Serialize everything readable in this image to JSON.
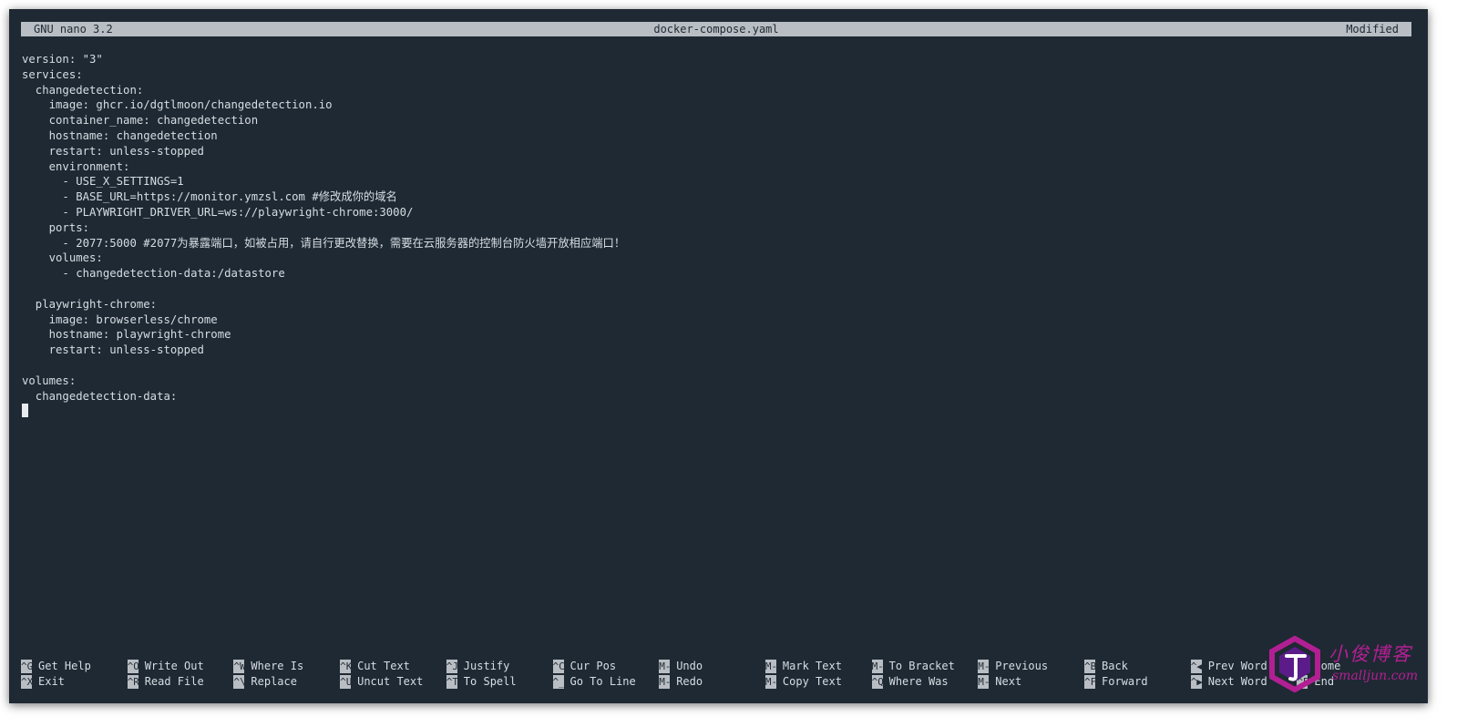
{
  "titlebar": {
    "app": "GNU nano 3.2",
    "filename": "docker-compose.yaml",
    "status": "Modified"
  },
  "editor": {
    "lines": [
      "version: \"3\"",
      "services:",
      "  changedetection:",
      "    image: ghcr.io/dgtlmoon/changedetection.io",
      "    container_name: changedetection",
      "    hostname: changedetection",
      "    restart: unless-stopped",
      "    environment:",
      "      - USE_X_SETTINGS=1",
      "      - BASE_URL=https://monitor.ymzsl.com #修改成你的域名",
      "      - PLAYWRIGHT_DRIVER_URL=ws://playwright-chrome:3000/",
      "    ports:",
      "      - 2077:5000 #2077为暴露端口，如被占用，请自行更改替换，需要在云服务器的控制台防火墙开放相应端口！",
      "    volumes:",
      "      - changedetection-data:/datastore",
      "",
      "  playwright-chrome:",
      "    image: browserless/chrome",
      "    hostname: playwright-chrome",
      "    restart: unless-stopped",
      "",
      "volumes:",
      "  changedetection-data:"
    ]
  },
  "shortcuts": [
    {
      "key": "^G",
      "label": "Get Help"
    },
    {
      "key": "^X",
      "label": "Exit"
    },
    {
      "key": "^O",
      "label": "Write Out"
    },
    {
      "key": "^R",
      "label": "Read File"
    },
    {
      "key": "^W",
      "label": "Where Is"
    },
    {
      "key": "^\\",
      "label": "Replace"
    },
    {
      "key": "^K",
      "label": "Cut Text"
    },
    {
      "key": "^U",
      "label": "Uncut Text"
    },
    {
      "key": "^J",
      "label": "Justify"
    },
    {
      "key": "^T",
      "label": "To Spell"
    },
    {
      "key": "^C",
      "label": "Cur Pos"
    },
    {
      "key": "^_",
      "label": "Go To Line"
    },
    {
      "key": "M-U",
      "label": "Undo"
    },
    {
      "key": "M-E",
      "label": "Redo"
    },
    {
      "key": "M-A",
      "label": "Mark Text"
    },
    {
      "key": "M-6",
      "label": "Copy Text"
    },
    {
      "key": "M-]",
      "label": "To Bracket"
    },
    {
      "key": "^Q",
      "label": "Where Was"
    },
    {
      "key": "M-Q",
      "label": "Previous"
    },
    {
      "key": "M-W",
      "label": "Next"
    },
    {
      "key": "^B",
      "label": "Back"
    },
    {
      "key": "^F",
      "label": "Forward"
    },
    {
      "key": "^◀",
      "label": "Prev Word"
    },
    {
      "key": "^▶",
      "label": "Next Word"
    },
    {
      "key": "^A",
      "label": "Home"
    },
    {
      "key": "^E",
      "label": "End"
    }
  ],
  "watermark": {
    "name": "小俊博客",
    "url": "smalljun.com",
    "logo_icon": "hexagon-logo-icon",
    "color": "#b21f93"
  },
  "colors": {
    "background": "#1f2933",
    "bar": "#b9bec4",
    "text": "#d6dde4"
  }
}
